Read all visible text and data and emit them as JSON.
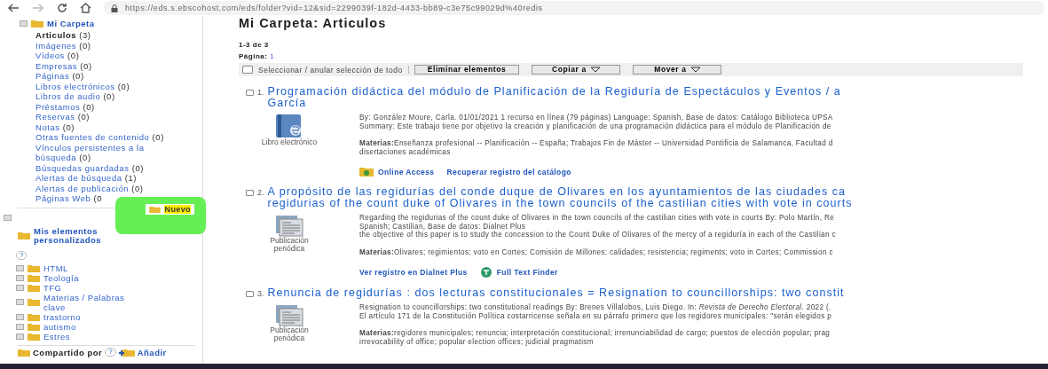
{
  "browser": {
    "url": "https://eds.s.ebscohost.com/eds/folder?vid=12&sid=2299039f-182d-4433-bb89-c3e75c99029d%40redis"
  },
  "sidebar": {
    "folder_title": "Mi Carpeta",
    "items": [
      {
        "label": "Articulos",
        "count": "(3)",
        "selected": true
      },
      {
        "label": "Imágenes",
        "count": "(0)",
        "selected": false
      },
      {
        "label": "Vídeos",
        "count": "(0)",
        "selected": false
      },
      {
        "label": "Empresas",
        "count": "(0)",
        "selected": false
      },
      {
        "label": "Páginas",
        "count": "(0)",
        "selected": false
      },
      {
        "label": "Libros electrónicos",
        "count": "(0)",
        "selected": false
      },
      {
        "label": "Libros de audio",
        "count": "(0)",
        "selected": false
      },
      {
        "label": "Préstamos",
        "count": "(0)",
        "selected": false
      },
      {
        "label": "Reservas",
        "count": "(0)",
        "selected": false
      },
      {
        "label": "Notas",
        "count": "(0)",
        "selected": false
      },
      {
        "label": "Otras fuentes de contenido",
        "count": "(0)",
        "selected": false
      },
      {
        "label": "Vínculos persistentes a la búsqueda",
        "count": "(0)",
        "selected": false
      },
      {
        "label": "Búsquedas guardadas",
        "count": "(0)",
        "selected": false
      },
      {
        "label": "Alertas de búsqueda",
        "count": "(1)",
        "selected": false
      },
      {
        "label": "Alertas de publicación",
        "count": "(0)",
        "selected": false
      },
      {
        "label": "Páginas Web",
        "count": "(0",
        "selected": false
      }
    ],
    "new_button": "Nuevo",
    "custom_title": "Mis elementos personalizados",
    "help": "?",
    "folders": [
      "HTML",
      "Teología",
      "TFG",
      "Materias / Palabras clave",
      "trastorno",
      "autismo",
      "Estres"
    ],
    "shared_title": "Compartido por",
    "add_button": "Añadir"
  },
  "main": {
    "title": "Mi Carpeta: Articulos",
    "range": "1-3 de 3",
    "page_label": "Página:",
    "page": "1",
    "toolbar": {
      "select_all": "Seleccionar / anular selección de todo",
      "select_all_checked": false,
      "delete": "Eliminar elementos",
      "copy": "Copiar a",
      "move": "Mover a"
    },
    "results": [
      {
        "number": "1.",
        "checked": false,
        "title_lines": [
          "Programación didáctica del módulo de Planificación de la Regiduría de Espectáculos y Eventos / a",
          "García"
        ],
        "kind": "ebook",
        "type_label": "Libro electrónico",
        "meta": [
          "By: González Moure, Carla. 01/01/2021 1 recurso en línea (79 páginas) Language: Spanish, Base de datos: Catálogo Biblioteca UPSA",
          "Summary: Este trabajo tiene por objetivo la creación y planificación de una programación didáctica para el módulo de Planificación de"
        ],
        "subjects_label": "Materias:",
        "subjects": [
          "Enseñanza profesional -- Planificación -- España; Trabajos Fin de Máster -- Universidad Pontificia de Salamanca, Facultad d",
          "disertaciones académicas"
        ],
        "links": [
          {
            "label": "Online Access",
            "kind": "online"
          },
          {
            "label": "Recuperar registro del catálogo",
            "kind": "plain"
          }
        ]
      },
      {
        "number": "2.",
        "checked": false,
        "title_lines": [
          "A propósito de las regidurías del conde duque de Olivares en los ayuntamientos de las ciudades ca",
          "regidurias of the count duke of Olivares in the town councils of the castilian cities with vote in courts"
        ],
        "kind": "periodical",
        "type_label": "Publicación periódica",
        "meta": [
          "Regarding the regidurias of the count duke of Olivares in the town councils of the castilian cities with vote in courts By: Polo Martín, Re",
          "Spanish; Castilian, Base de datos: Dialnet Plus",
          "the objective of this paper is to study the concession to the Count Duke of Olivares of the mercy of a regiduría in each of the Castilian c"
        ],
        "subjects_label": "Materias:",
        "subjects": [
          "Olivares; regimientos; voto en Cortes; Comisión de Millones; calidades; resistencia; regiments; voto in Cortes; Commission c"
        ],
        "links": [
          {
            "label": "Ver registro en Dialnet Plus",
            "kind": "plain"
          },
          {
            "label": "Full Text Finder",
            "kind": "finder"
          }
        ]
      },
      {
        "number": "3.",
        "checked": false,
        "title_lines": [
          "Renuncia de regidurías : dos lecturas constitucionales = Resignation to councillorships: two constit"
        ],
        "kind": "periodical",
        "type_label": "Publicación periódica",
        "meta": [
          "Resignation to councillorships: two constitutional readings By: Brenes Villalobos, Luis Diego. In: *Revista de Derecho Electoral*. 2022 (.",
          "El artículo 171 de la Constitución Política costarricense señala en su párrafo primero que los regidores municipales: \"serán elegidos p"
        ],
        "subjects_label": "Materias:",
        "subjects": [
          "regidores municipales; renuncia; interpretación constitucional; irrenunciabilidad de cargo; puestos de elección popular; prag",
          "irrevocability of office; popular election offices; judicial pragmatism"
        ]
      }
    ]
  }
}
